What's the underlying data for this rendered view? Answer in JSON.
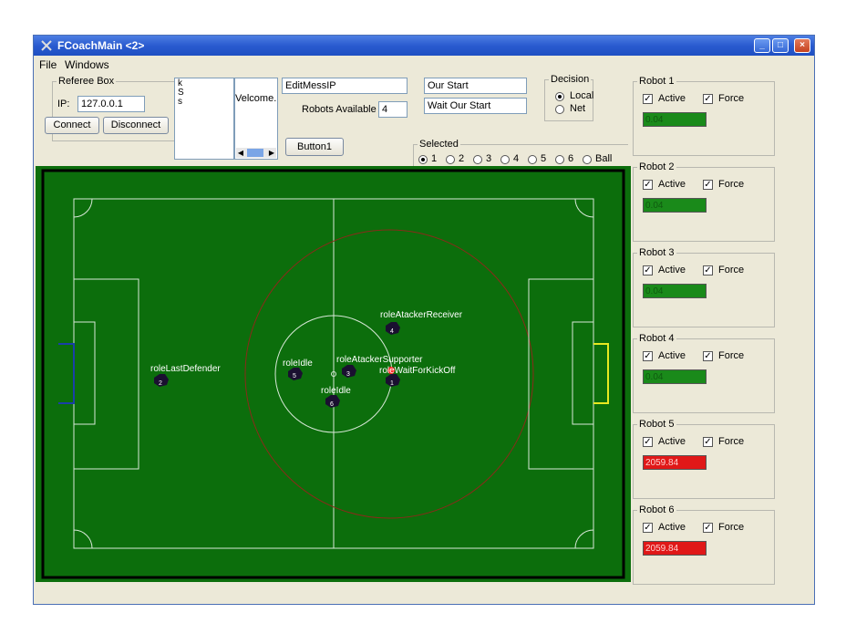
{
  "window": {
    "title": "FCoachMain <2>"
  },
  "menu": [
    "File",
    "Windows"
  ],
  "referee_box": {
    "legend": "Referee Box",
    "ip_label": "IP:",
    "ip_value": "127.0.0.1",
    "connect": "Connect",
    "disconnect": "Disconnect"
  },
  "text_list": [
    "k",
    "S",
    "s"
  ],
  "welcome_text": "Velcome.",
  "edit_mess_ip": "EditMessIP",
  "robots_available": {
    "label": "Robots Available",
    "value": "4"
  },
  "button1": "Button1",
  "our_start": "Our Start",
  "wait_our_start": "Wait Our Start",
  "decision": {
    "legend": "Decision",
    "options": [
      "Local",
      "Net"
    ],
    "selected": "Local"
  },
  "selected": {
    "legend": "Selected",
    "options": [
      "1",
      "2",
      "3",
      "4",
      "5",
      "6",
      "Ball"
    ],
    "selected": "1"
  },
  "robots": [
    {
      "name": "Robot 1",
      "active_label": "Active",
      "force_label": "Force",
      "value": "0.04",
      "color": "#1a8a1a"
    },
    {
      "name": "Robot 2",
      "active_label": "Active",
      "force_label": "Force",
      "value": "0.04",
      "color": "#1a8a1a"
    },
    {
      "name": "Robot 3",
      "active_label": "Active",
      "force_label": "Force",
      "value": "0.04",
      "color": "#1a8a1a"
    },
    {
      "name": "Robot 4",
      "active_label": "Active",
      "force_label": "Force",
      "value": "0.04",
      "color": "#1a8a1a"
    },
    {
      "name": "Robot 5",
      "active_label": "Active",
      "force_label": "Force",
      "value": "2059.84",
      "color": "#e01818"
    },
    {
      "name": "Robot 6",
      "active_label": "Active",
      "force_label": "Force",
      "value": "2059.84",
      "color": "#e01818"
    }
  ],
  "roles": {
    "last_defender": "roleLastDefender",
    "idle_a": "roleIdle",
    "idle_b": "roleIdle",
    "atacker_supporter": "roleAtackerSupporter",
    "atacker_receiver": "roleAtackerReceiver",
    "wait_kickoff": "roleWaitForKickOff"
  },
  "robot_numbers": [
    "1",
    "2",
    "3",
    "4",
    "5",
    "6"
  ],
  "colors": {
    "pitch": "#0c6e0c",
    "goal_left": "#1a3fa8",
    "goal_right": "#e8e820",
    "ball": "#ff2020",
    "titlebar": "#2a5bd0"
  }
}
